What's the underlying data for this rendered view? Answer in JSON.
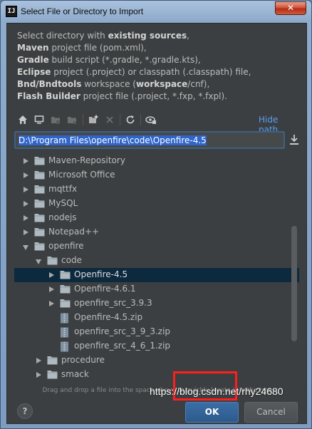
{
  "window": {
    "title": "Select File or Directory to Import",
    "app_icon_text": "IJ",
    "close_glyph": "✕"
  },
  "description": {
    "line1_pre": "Select directory with ",
    "line1_bold": "existing sources",
    "line1_post": ",",
    "line2_bold": "Maven",
    "line2_post": " project file (pom.xml),",
    "line3_bold": "Gradle",
    "line3_post": " build script (*.gradle, *.gradle.kts),",
    "line4_bold": "Eclipse",
    "line4_post": " project (.project) or classpath (.classpath) file,",
    "line5_bold": "Bnd/Bndtools",
    "line5_mid": " workspace (",
    "line5_bold2": "workspace",
    "line5_post": "/cnf),",
    "line6_bold": "Flash Builder",
    "line6_post": " project file (.project, *.fxp, *.fxpl)."
  },
  "toolbar": {
    "icons": [
      "home-icon",
      "desktop-icon",
      "project-icon",
      "module-icon",
      "new-folder-icon",
      "delete-icon",
      "refresh-icon",
      "show-hidden-icon"
    ],
    "hide_path_label": "Hide path"
  },
  "path_field": {
    "value": "D:\\Program Files\\openfire\\code\\Openfire-4.5"
  },
  "tree": {
    "nodes": [
      {
        "label": "Maven-Repository",
        "depth": 2,
        "expander": "right",
        "icon": "folder"
      },
      {
        "label": "Microsoft Office",
        "depth": 2,
        "expander": "right",
        "icon": "folder"
      },
      {
        "label": "mqttfx",
        "depth": 2,
        "expander": "right",
        "icon": "folder"
      },
      {
        "label": "MySQL",
        "depth": 2,
        "expander": "right",
        "icon": "folder"
      },
      {
        "label": "nodejs",
        "depth": 2,
        "expander": "right",
        "icon": "folder"
      },
      {
        "label": "Notepad++",
        "depth": 2,
        "expander": "right",
        "icon": "folder"
      },
      {
        "label": "openfire",
        "depth": 2,
        "expander": "down",
        "icon": "folder"
      },
      {
        "label": "code",
        "depth": 3,
        "expander": "down",
        "icon": "folder"
      },
      {
        "label": "Openfire-4.5",
        "depth": 4,
        "expander": "right",
        "icon": "folder",
        "selected": true
      },
      {
        "label": "Openfire-4.6.1",
        "depth": 4,
        "expander": "right",
        "icon": "folder"
      },
      {
        "label": "openfire_src_3.9.3",
        "depth": 4,
        "expander": "right",
        "icon": "folder"
      },
      {
        "label": "Openfire-4.5.zip",
        "depth": 4,
        "expander": "none",
        "icon": "archive"
      },
      {
        "label": "openfire_src_3_9_3.zip",
        "depth": 4,
        "expander": "none",
        "icon": "archive"
      },
      {
        "label": "openfire_src_4_6_1.zip",
        "depth": 4,
        "expander": "none",
        "icon": "archive"
      },
      {
        "label": "procedure",
        "depth": 3,
        "expander": "right",
        "icon": "folder"
      },
      {
        "label": "smack",
        "depth": 3,
        "expander": "right",
        "icon": "folder"
      }
    ]
  },
  "hint_text": "Drag and drop a file into the space above to quickly locate it in the tree",
  "buttons": {
    "help": "?",
    "ok": "OK",
    "cancel": "Cancel"
  },
  "watermark": "https://blog.csdn.net/rhy24680",
  "colors": {
    "background": "#3c3f41",
    "selection": "#0d293e",
    "link": "#589df6",
    "ok_button": "#365880",
    "highlight_box": "#ff1e1e"
  }
}
